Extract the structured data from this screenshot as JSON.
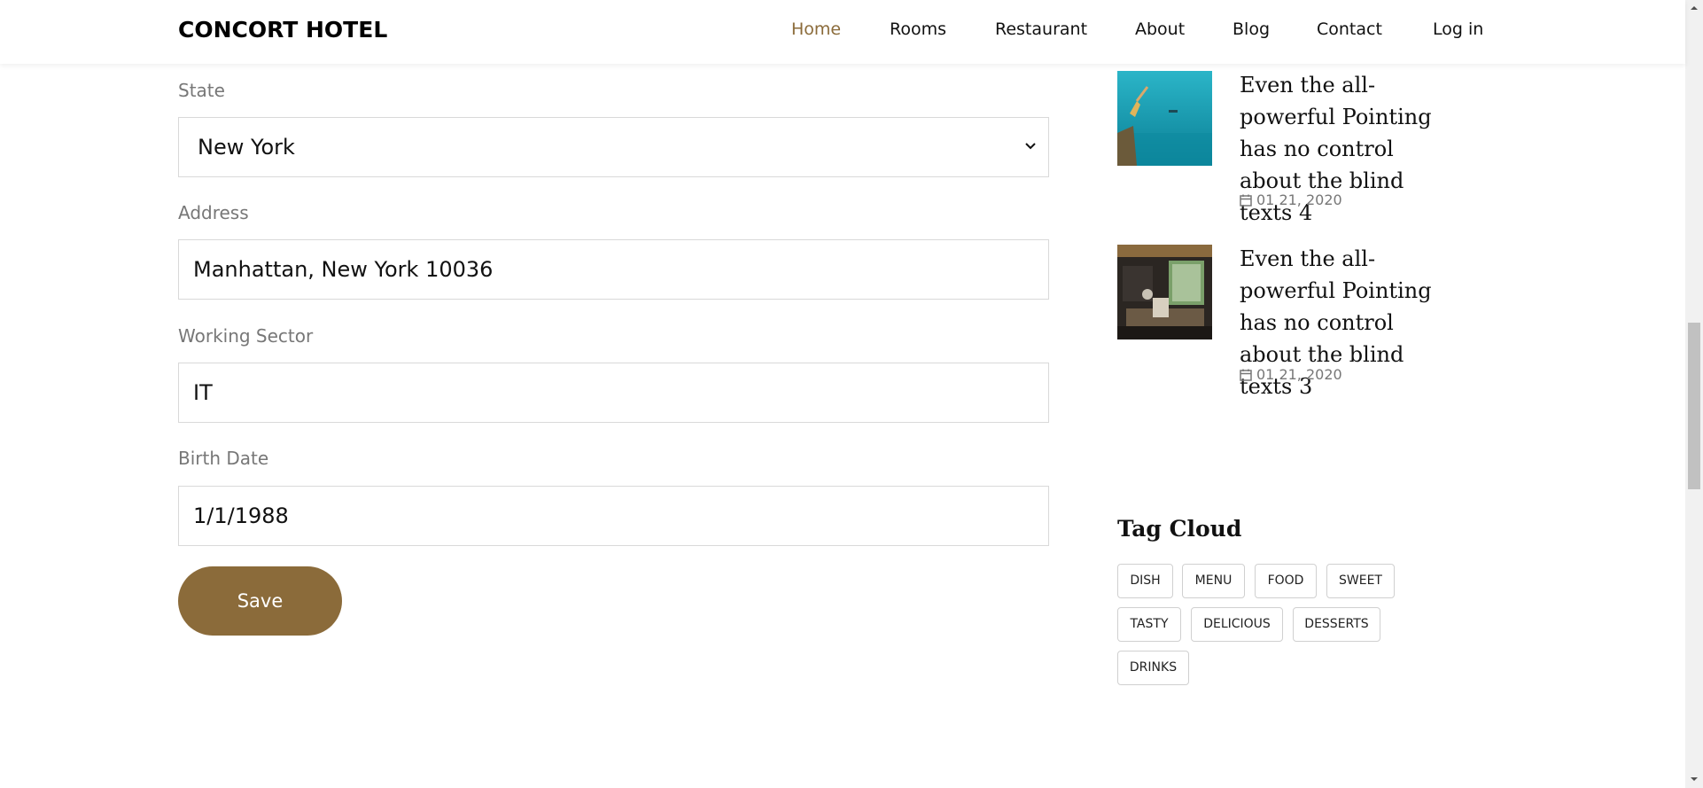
{
  "nav": {
    "brand": "CONCORT HOTEL",
    "links": [
      "Home",
      "Rooms",
      "Restaurant",
      "About",
      "Blog",
      "Contact",
      "Log in"
    ],
    "active_color": "#8b6b3a"
  },
  "form": {
    "state": {
      "label": "State",
      "value": "New York"
    },
    "address": {
      "label": "Address",
      "value": "Manhattan, New York 10036"
    },
    "sector": {
      "label": "Working Sector",
      "value": "IT"
    },
    "birth": {
      "label": "Birth Date",
      "value": "1/1/1988"
    },
    "save_label": "Save",
    "button_color": "#8b6b3a"
  },
  "sidebar": {
    "posts": [
      {
        "title": "Even the all-powerful Pointing has no control about the blind texts 4",
        "date": "01 21, 2020",
        "thumb": "beach-jump-photo"
      },
      {
        "title": "Even the all-powerful Pointing has no control about the blind texts 3",
        "date": "01 21, 2020",
        "thumb": "restaurant-interior-photo"
      }
    ],
    "tag_cloud_title": "Tag Cloud",
    "tags": [
      "DISH",
      "MENU",
      "FOOD",
      "SWEET",
      "TASTY",
      "DELICIOUS",
      "DESSERTS",
      "DRINKS"
    ]
  }
}
